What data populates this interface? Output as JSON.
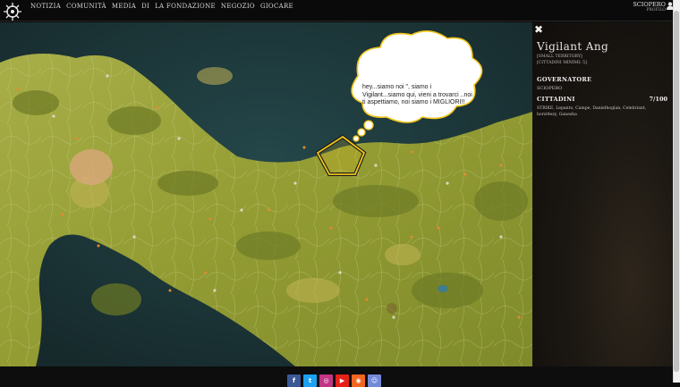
{
  "nav": {
    "items": [
      "NOTIZIA",
      "COMUNITÀ",
      "MEDIA",
      "DI",
      "LA FONDAZIONE",
      "NEGOZIO",
      "GIOCARE"
    ]
  },
  "user": {
    "name": "SCIOPERO",
    "profile_label": "PROFILO"
  },
  "map": {
    "bubble_text": "hey...siamo noi \", siamo i Vigilant...siamo qui, vieni a trovarci ..noi ti aspettiamo, noi siamo i MIGLIORI!!",
    "colors": {
      "sea": "#1f3a3b",
      "land": "#9aa23a",
      "highlight": "#f2c41a",
      "bubble": "#ffffff",
      "bubble_border": "#f2c41a"
    },
    "icons": [
      "fort-marker-icon",
      "territory-highlight-icon"
    ]
  },
  "panel": {
    "close_icon": "close-icon",
    "title": "Vigilant Ang",
    "sub1": "[SMALL TERRITORY]",
    "sub2": "[CITTADINI MINIMI: 5]",
    "governor_heading": "GOVERNATORE",
    "governor": "SCIOPERO",
    "citizens_heading": "CITTADINI",
    "citizens_count": "7/100",
    "citizens_list": "STRIKE, Lepanto, Campe, Danielhoglan, Celebriant, horsl4ezy, Ganesha"
  },
  "footer": {
    "social": [
      {
        "name": "facebook-icon",
        "glyph": "f",
        "color": "#3b5998"
      },
      {
        "name": "twitter-icon",
        "glyph": "t",
        "color": "#1da1f2"
      },
      {
        "name": "instagram-icon",
        "glyph": "◎",
        "color": "#c13584"
      },
      {
        "name": "youtube-icon",
        "glyph": "▶",
        "color": "#e62117"
      },
      {
        "name": "rss-icon",
        "glyph": "◉",
        "color": "#f26522"
      },
      {
        "name": "discord-icon",
        "glyph": "☺",
        "color": "#7289da"
      }
    ]
  }
}
